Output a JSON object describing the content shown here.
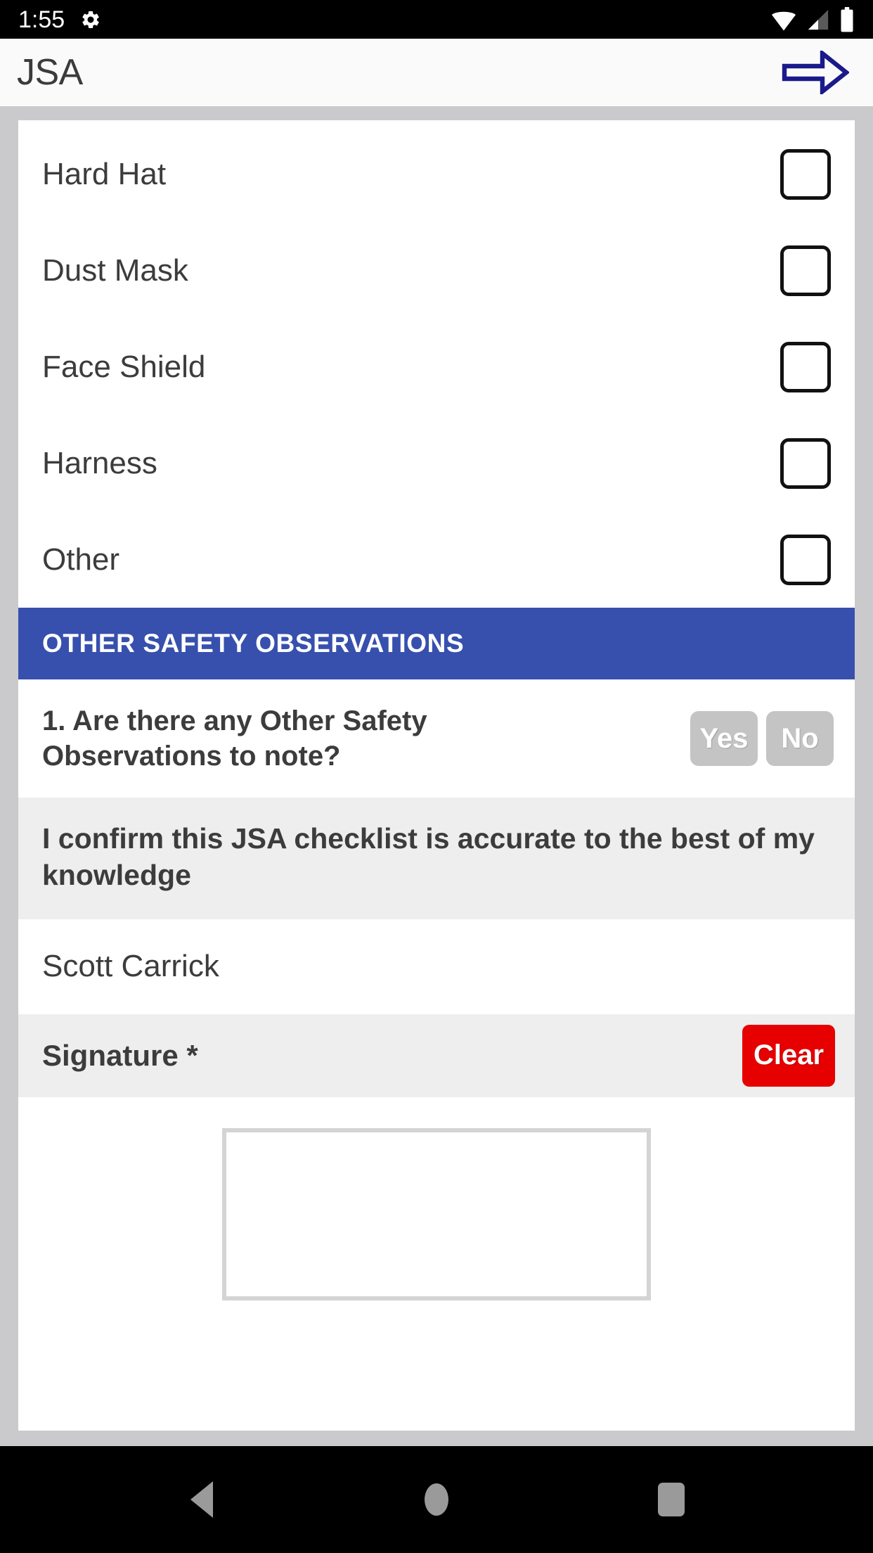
{
  "status_bar": {
    "time": "1:55",
    "icons": [
      "gear-icon",
      "wifi-icon",
      "signal-icon",
      "battery-icon"
    ],
    "background": "#000000",
    "foreground": "#ffffff"
  },
  "app_bar": {
    "title": "JSA",
    "next_action": "next-arrow-icon",
    "arrow_color": "#1a1a8c",
    "background": "#fafafa"
  },
  "ppe_checklist": {
    "items": [
      {
        "label": "Hard Hat",
        "checked": false
      },
      {
        "label": "Dust Mask",
        "checked": false
      },
      {
        "label": "Face Shield",
        "checked": false
      },
      {
        "label": "Harness",
        "checked": false
      },
      {
        "label": "Other",
        "checked": false
      }
    ]
  },
  "section": {
    "header": "OTHER SAFETY OBSERVATIONS",
    "header_color": "#3750ae"
  },
  "question": {
    "text": "1. Are there any Other Safety Observations to note?",
    "options": [
      {
        "label": "Yes",
        "selected": false
      },
      {
        "label": "No",
        "selected": false
      }
    ],
    "option_color": "#c4c4c4"
  },
  "confirmation": {
    "text": "I confirm this JSA checklist is accurate to the best of my knowledge"
  },
  "name_field": {
    "value": "Scott Carrick"
  },
  "signature": {
    "label": "Signature *",
    "clear_label": "Clear",
    "clear_color": "#e60000",
    "pad_empty": true
  },
  "nav_bar": {
    "buttons": [
      "back-icon",
      "home-icon",
      "recents-icon"
    ],
    "icon_color": "#9a9a9a"
  }
}
